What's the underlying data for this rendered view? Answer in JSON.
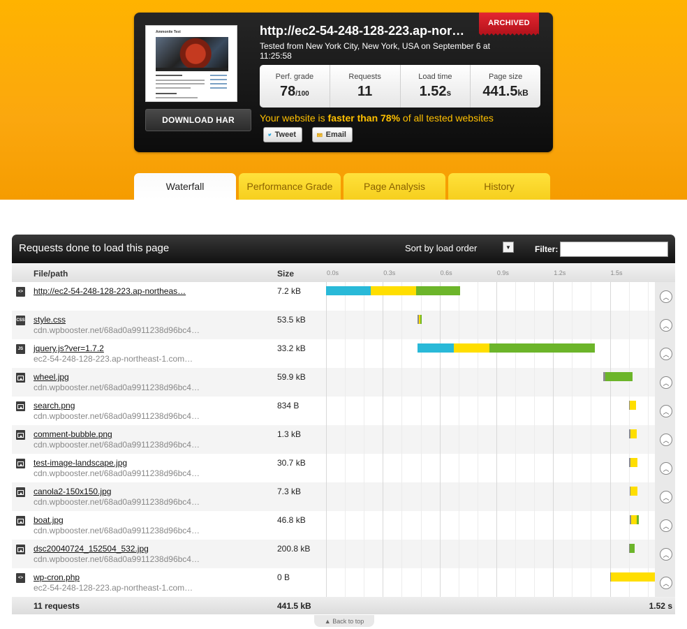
{
  "header": {
    "url_title": "http://ec2-54-248-128-223.ap-nor…",
    "badge": "ARCHIVED",
    "tested_text": "Tested from New York City, New York, USA on September 6 at 11:25:58",
    "download_label": "DOWNLOAD HAR",
    "thumb_title": "Ammonite Test",
    "stats": {
      "grade_label": "Perf. grade",
      "grade_value": "78",
      "grade_unit": "/100",
      "requests_label": "Requests",
      "requests_value": "11",
      "load_label": "Load time",
      "load_value": "1.52",
      "load_unit": "s",
      "size_label": "Page size",
      "size_value": "441.5",
      "size_unit": "kB"
    },
    "faster_pre": "Your website is ",
    "faster_bold": "faster than 78%",
    "faster_post": " of all tested websites",
    "tweet_label": "Tweet",
    "email_label": "Email"
  },
  "tabs": [
    "Waterfall",
    "Performance Grade",
    "Page Analysis",
    "History"
  ],
  "panel": {
    "title": "Requests done to load this page",
    "sort_label": "Sort by load order",
    "filter_label": "Filter:",
    "col_file": "File/path",
    "col_size": "Size",
    "ticks": [
      "0.0s",
      "0.3s",
      "0.6s",
      "0.9s",
      "1.2s",
      "1.5s"
    ],
    "footer": {
      "requests": "11 requests",
      "size": "441.5 kB",
      "time": "1.52 s"
    },
    "back_to_top": "Back to top"
  },
  "rows": [
    {
      "type": "html",
      "icon": "html-file-icon",
      "name": "http://ec2-54-248-128-223.ap-northeas…",
      "host": "",
      "size": "7.2 kB",
      "timing": [
        [
          "connect2",
          0.0,
          0.235
        ],
        [
          "wait",
          0.235,
          0.475
        ],
        [
          "receive",
          0.475,
          0.71
        ]
      ]
    },
    {
      "type": "css",
      "icon": "css-file-icon",
      "name": "style.css",
      "host": "cdn.wpbooster.net/68ad0a9911238d96bc4…",
      "size": "53.5 kB",
      "timing": [
        [
          "blocked",
          0.483,
          0.49
        ],
        [
          "wait",
          0.49,
          0.497
        ],
        [
          "receive",
          0.497,
          0.503
        ]
      ]
    },
    {
      "type": "js",
      "icon": "js-file-icon",
      "name": "jquery.js?ver=1.7.2",
      "host": "ec2-54-248-128-223.ap-northeast-1.com…",
      "size": "33.2 kB",
      "timing": [
        [
          "connect2",
          0.483,
          0.675
        ],
        [
          "wait",
          0.675,
          0.865
        ],
        [
          "receive",
          0.865,
          1.42
        ]
      ]
    },
    {
      "type": "img",
      "icon": "image-file-icon",
      "name": "wheel.jpg",
      "host": "cdn.wpbooster.net/68ad0a9911238d96bc4…",
      "size": "59.9 kB",
      "timing": [
        [
          "blocked",
          1.465,
          1.475
        ],
        [
          "receive",
          1.475,
          1.62
        ]
      ]
    },
    {
      "type": "img",
      "icon": "image-file-icon",
      "name": "search.png",
      "host": "cdn.wpbooster.net/68ad0a9911238d96bc4…",
      "size": "834 B",
      "timing": [
        [
          "blocked",
          1.6,
          1.607
        ],
        [
          "wait",
          1.607,
          1.64
        ]
      ]
    },
    {
      "type": "img",
      "icon": "image-file-icon",
      "name": "comment-bubble.png",
      "host": "cdn.wpbooster.net/68ad0a9911238d96bc4…",
      "size": "1.3 kB",
      "timing": [
        [
          "blocked",
          1.603,
          1.61
        ],
        [
          "wait",
          1.61,
          1.642
        ]
      ]
    },
    {
      "type": "img",
      "icon": "image-file-icon",
      "name": "test-image-landscape.jpg",
      "host": "cdn.wpbooster.net/68ad0a9911238d96bc4…",
      "size": "30.7 kB",
      "timing": [
        [
          "blocked",
          1.603,
          1.61
        ],
        [
          "wait",
          1.61,
          1.645
        ]
      ]
    },
    {
      "type": "img",
      "icon": "image-file-icon",
      "name": "canola2-150x150.jpg",
      "host": "cdn.wpbooster.net/68ad0a9911238d96bc4…",
      "size": "7.3 kB",
      "timing": [
        [
          "blocked",
          1.605,
          1.61
        ],
        [
          "wait",
          1.61,
          1.645
        ]
      ]
    },
    {
      "type": "img",
      "icon": "image-file-icon",
      "name": "boat.jpg",
      "host": "cdn.wpbooster.net/68ad0a9911238d96bc4…",
      "size": "46.8 kB",
      "timing": [
        [
          "blocked",
          1.605,
          1.612
        ],
        [
          "wait",
          1.612,
          1.642
        ],
        [
          "receive",
          1.642,
          1.655
        ]
      ]
    },
    {
      "type": "img",
      "icon": "image-file-icon",
      "name": "dsc20040724_152504_532.jpg",
      "host": "cdn.wpbooster.net/68ad0a9911238d96bc4…",
      "size": "200.8 kB",
      "timing": [
        [
          "blocked",
          1.6,
          1.607
        ],
        [
          "receive",
          1.607,
          1.63
        ]
      ]
    },
    {
      "type": "php",
      "icon": "html-file-icon",
      "name": "wp-cron.php",
      "host": "ec2-54-248-128-223.ap-northeast-1.com…",
      "size": "0 B",
      "timing": [
        [
          "blocked",
          1.5,
          1.507
        ],
        [
          "wait",
          1.507,
          1.755
        ]
      ]
    }
  ],
  "colors": {
    "band": "#fba70e",
    "tab_active": "#ffffff",
    "tab_inactive": "#f6cf1e",
    "wait": "#ffde00",
    "receive": "#6cb52a",
    "connect": "#29b9d8",
    "blocked": "#8c8c8c"
  }
}
